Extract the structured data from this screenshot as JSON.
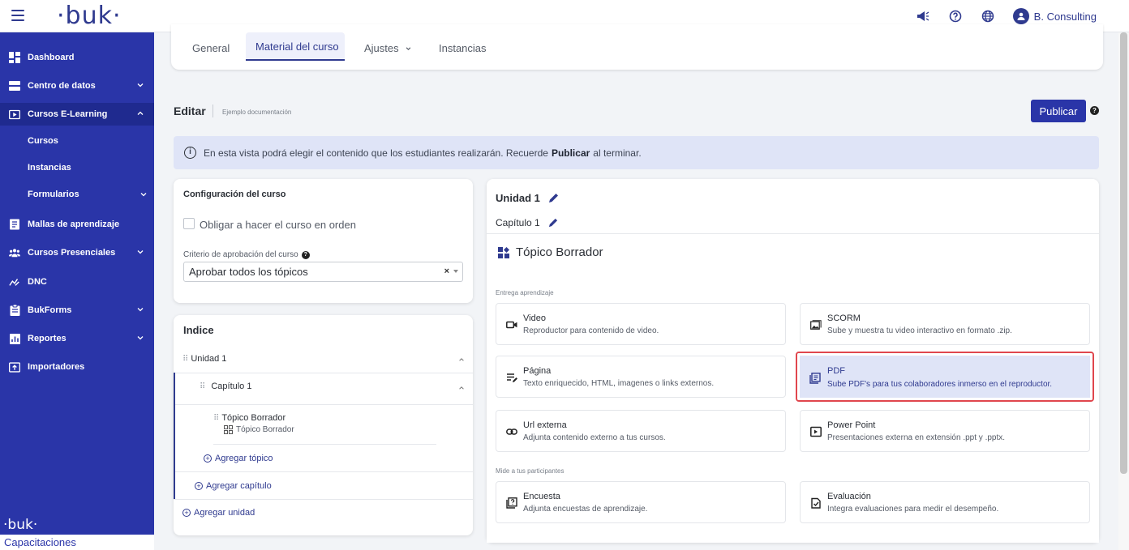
{
  "brand": {
    "logo": "·buk·",
    "footer_logo": "·buk·",
    "footer_text": "Capacitaciones"
  },
  "topbar": {
    "user_name": "B. Consulting"
  },
  "sidebar": {
    "items": [
      {
        "label": "Dashboard"
      },
      {
        "label": "Centro de datos"
      },
      {
        "label": "Cursos E-Learning"
      },
      {
        "label": "Mallas de aprendizaje"
      },
      {
        "label": "Cursos Presenciales"
      },
      {
        "label": "DNC"
      },
      {
        "label": "BukForms"
      },
      {
        "label": "Reportes"
      },
      {
        "label": "Importadores"
      }
    ],
    "subitems": [
      {
        "label": "Cursos"
      },
      {
        "label": "Instancias"
      },
      {
        "label": "Formularios"
      }
    ]
  },
  "tabs": [
    {
      "label": "General"
    },
    {
      "label": "Material del curso"
    },
    {
      "label": "Ajustes"
    },
    {
      "label": "Instancias"
    }
  ],
  "editor": {
    "title": "Editar",
    "subtitle": "Ejemplo documentación",
    "publish_label": "Publicar",
    "help": "?"
  },
  "banner": {
    "text_before": "En esta vista podrá elegir el contenido que los estudiantes realizarán. Recuerde",
    "bold": "Publicar",
    "text_after": "al terminar.",
    "icon": "i"
  },
  "config": {
    "title": "Configuración del curso",
    "checkbox_label": "Obligar a hacer el curso en orden",
    "criterio_label": "Criterio de aprobación del curso",
    "select_value": "Aprobar todos los tópicos",
    "clear": "×"
  },
  "indice": {
    "title": "Indice",
    "unit": "Unidad 1",
    "chapter": "Capítulo 1",
    "topic": "Tópico Borrador",
    "topic_sub": "Tópico Borrador",
    "add_topic": "Agregar tópico",
    "add_chapter": "Agregar capítulo",
    "add_unit": "Agregar unidad"
  },
  "content": {
    "unit_header": "Unidad 1",
    "chapter_header": "Capítulo 1",
    "topic_title": "Tópico Borrador",
    "section_delivery": "Entrega aprendizaje",
    "section_measure": "Mide a tus participantes",
    "options": [
      {
        "title": "Video",
        "desc": "Reproductor para contenido de video."
      },
      {
        "title": "SCORM",
        "desc": "Sube y muestra tu video interactivo en formato .zip."
      },
      {
        "title": "Página",
        "desc": "Texto enriquecido, HTML, imagenes o links externos."
      },
      {
        "title": "PDF",
        "desc": "Sube PDF's para tus colaboradores inmerso en el reproductor."
      },
      {
        "title": "Url externa",
        "desc": "Adjunta contenido externo a tus cursos."
      },
      {
        "title": "Power Point",
        "desc": "Presentaciones externa en extensión .ppt y .pptx."
      },
      {
        "title": "Encuesta",
        "desc": "Adjunta encuestas de aprendizaje."
      },
      {
        "title": "Evaluación",
        "desc": "Integra evaluaciones para medir el desempeño."
      }
    ]
  },
  "colors": {
    "primary": "#2a35a8",
    "selected_border": "#e0464d",
    "banner_bg": "#dfe4f7"
  }
}
